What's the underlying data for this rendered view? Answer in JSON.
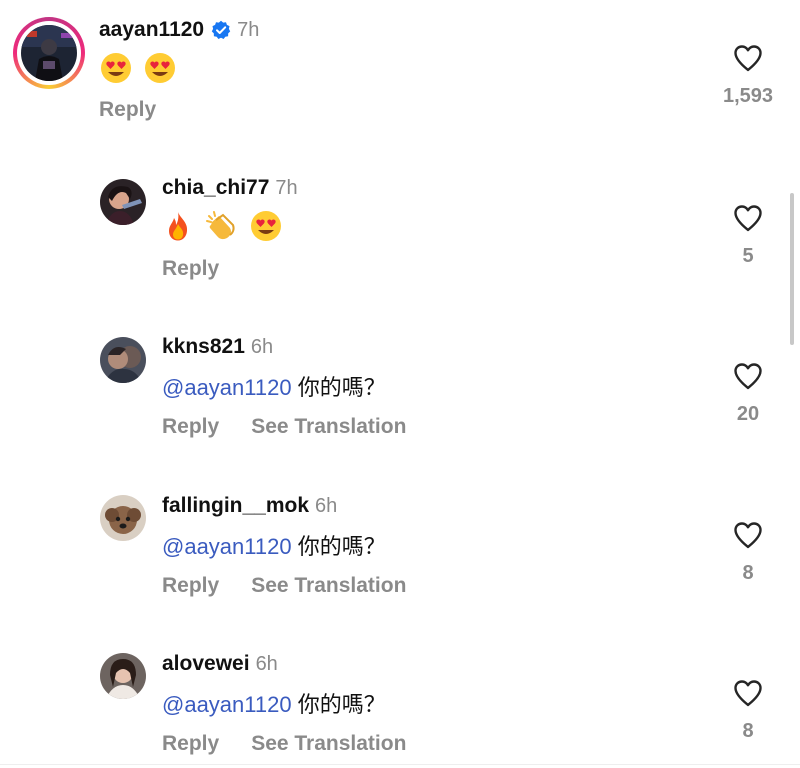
{
  "comments": [
    {
      "username": "aayan1120",
      "verified": true,
      "time": "7h",
      "emojis": [
        "heart-eyes",
        "heart-eyes"
      ],
      "actions": {
        "reply": "Reply"
      },
      "likes": "1,593",
      "story_ring": true
    },
    {
      "username": "chia_chi77",
      "time": "7h",
      "emojis": [
        "fire",
        "clapping-hands",
        "heart-eyes"
      ],
      "actions": {
        "reply": "Reply"
      },
      "likes": "5"
    },
    {
      "username": "kkns821",
      "time": "6h",
      "mention": "@aayan1120",
      "text": " 你的嗎？",
      "actions": {
        "reply": "Reply",
        "translate": "See Translation"
      },
      "likes": "20"
    },
    {
      "username": "fallingin__mok",
      "time": "6h",
      "mention": "@aayan1120",
      "text": " 你的嗎？",
      "actions": {
        "reply": "Reply",
        "translate": "See Translation"
      },
      "likes": "8"
    },
    {
      "username": "alovewei",
      "time": "6h",
      "mention": "@aayan1120",
      "text": " 你的嗎？",
      "actions": {
        "reply": "Reply",
        "translate": "See Translation"
      },
      "likes": "8"
    }
  ],
  "colors": {
    "mention": "#3a5bbf",
    "muted": "#8a8a8a",
    "verified": "#1877f2"
  }
}
